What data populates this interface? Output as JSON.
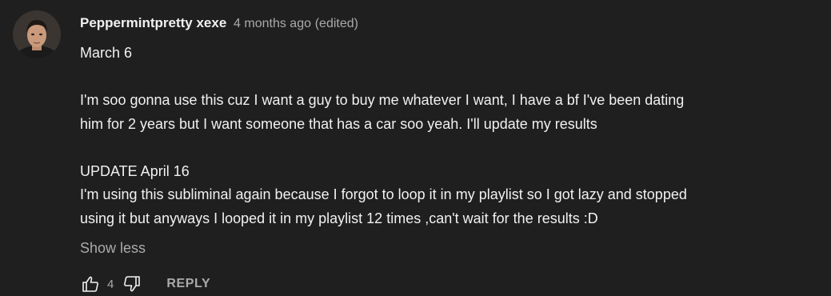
{
  "comment": {
    "author": "Peppermintpretty xexe",
    "timestamp": "4 months ago",
    "edited_label": "(edited)",
    "lines": [
      "March 6",
      "",
      "I'm soo gonna use this cuz I want a guy to buy me whatever I want, I have a bf I've been dating",
      "him for 2 years but I want someone that has a car soo yeah. I'll update my results",
      "",
      "UPDATE April 16",
      "I'm using this subliminal again because I forgot to loop it in my playlist so I got lazy and stopped",
      "using it but anyways I looped it in my playlist 12 times ,can't wait for the results :D"
    ],
    "show_less_label": "Show less"
  },
  "actions": {
    "like_count": "4",
    "reply_label": "REPLY",
    "like_icon": "thumbs-up-icon",
    "dislike_icon": "thumbs-down-icon"
  },
  "colors": {
    "background": "#1f1f1f",
    "primary_text": "#f1f1f1",
    "secondary_text": "#aaaaaa"
  }
}
